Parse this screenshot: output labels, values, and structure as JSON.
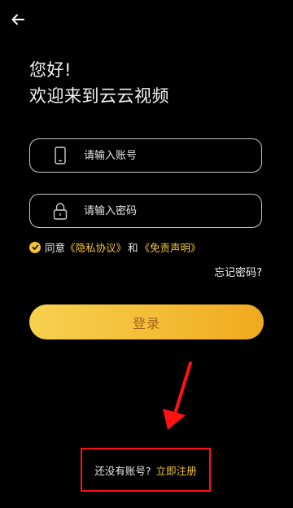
{
  "header": {
    "back_icon": "arrow-left-icon"
  },
  "greeting": {
    "line1": "您好!",
    "line2": "欢迎来到云云视频"
  },
  "account_field": {
    "placeholder": "请输入账号",
    "icon": "phone-icon"
  },
  "password_field": {
    "placeholder": "请输入密码",
    "icon": "lock-icon"
  },
  "agreement": {
    "prefix": "同意",
    "privacy": "《隐私协议》",
    "and": "和",
    "disclaimer": "《免责声明》",
    "checked": true
  },
  "forgot_password": "忘记密码?",
  "login_button": "登录",
  "register": {
    "question": "还没有账号?",
    "link": "立即注册"
  },
  "colors": {
    "accent": "#f3c437",
    "highlight_box": "#ff1212",
    "arrow": "#ff1212",
    "background": "#000000"
  }
}
